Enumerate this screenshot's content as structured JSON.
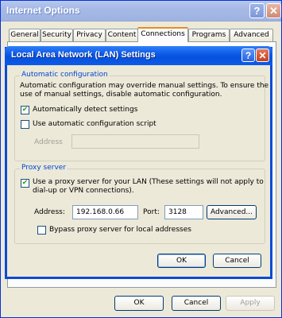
{
  "outer_window": {
    "title": "Internet Options",
    "help_glyph": "?",
    "close_glyph": "✕",
    "tabs": [
      "General",
      "Security",
      "Privacy",
      "Content",
      "Connections",
      "Programs",
      "Advanced"
    ],
    "active_tab": "Connections",
    "buttons": {
      "ok": "OK",
      "cancel": "Cancel",
      "apply": "Apply"
    }
  },
  "lan_dialog": {
    "title": "Local Area Network (LAN) Settings",
    "help_glyph": "?",
    "close_glyph": "✕",
    "automatic_configuration": {
      "legend": "Automatic configuration",
      "description_line1": "Automatic configuration may override manual settings.  To ensure the",
      "description_line2": "use of manual settings, disable automatic configuration.",
      "auto_detect": {
        "label": "Automatically detect settings",
        "checked": true
      },
      "use_script": {
        "label": "Use automatic configuration script",
        "checked": false
      },
      "address_label": "Address",
      "address_value": ""
    },
    "proxy_server": {
      "legend": "Proxy server",
      "use_proxy": {
        "label_line1": "Use a proxy server for your LAN (These settings will not apply to",
        "label_line2": "dial-up or VPN connections).",
        "checked": true
      },
      "address_label": "Address:",
      "address_value": "192.168.0.66",
      "port_label": "Port:",
      "port_value": "3128",
      "advanced_button": "Advanced...",
      "bypass_local": {
        "label": "Bypass proxy server for local addresses",
        "checked": false
      }
    },
    "buttons": {
      "ok": "OK",
      "cancel": "Cancel"
    }
  },
  "colors": {
    "window_bg": "#ece9d8",
    "titlebar_active": "#0a58e6",
    "group_legend": "#0046d5",
    "check_mark": "#21a121"
  }
}
